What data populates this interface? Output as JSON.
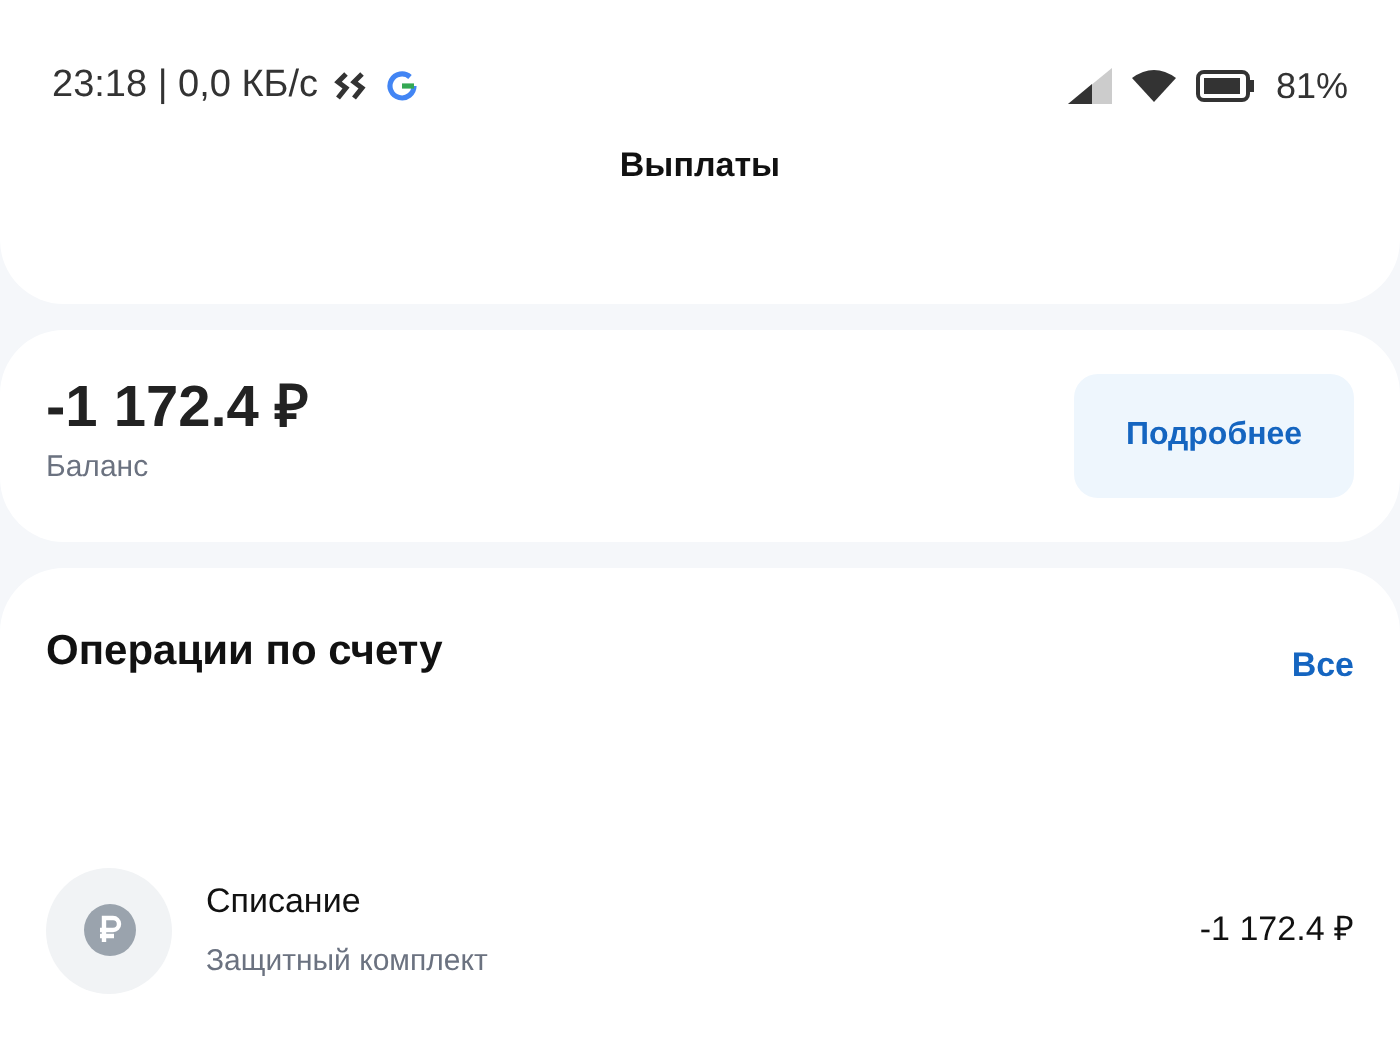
{
  "status_bar": {
    "time_speed": "23:18 | 0,0 КБ/с",
    "battery": "81%"
  },
  "header": {
    "title": "Выплаты"
  },
  "balance": {
    "amount": "-1 172.4 ₽",
    "label": "Баланс",
    "button": "Подробнее"
  },
  "operations": {
    "title": "Операции по счету",
    "all_link": "Все",
    "items": [
      {
        "title": "Списание",
        "subtitle": "Защитный комплект",
        "amount": "-1 172.4 ₽"
      }
    ]
  }
}
